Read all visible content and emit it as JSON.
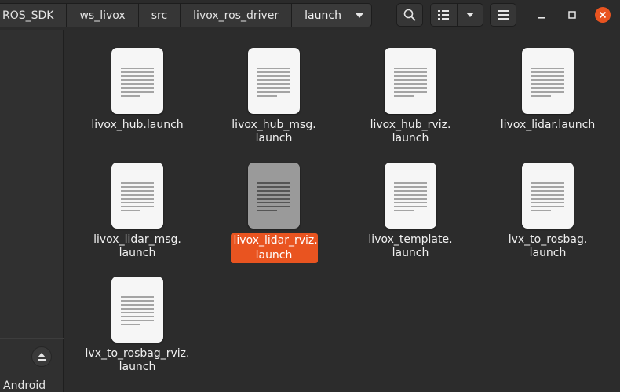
{
  "breadcrumbs": [
    {
      "label": "ROS_SDK"
    },
    {
      "label": "ws_livox"
    },
    {
      "label": "src"
    },
    {
      "label": "livox_ros_driver"
    },
    {
      "label": "launch"
    }
  ],
  "toolbar": {
    "search_icon": "search-icon",
    "view_icon": "list-view-icon",
    "view_options_icon": "chevron-down-icon",
    "menu_icon": "hamburger-menu-icon"
  },
  "sidebar": {
    "device_label": "Android",
    "eject_icon": "eject-icon"
  },
  "files": [
    {
      "line1": "livox_hub.launch",
      "line2": ""
    },
    {
      "line1": "livox_hub_msg.",
      "line2": "launch"
    },
    {
      "line1": "livox_hub_rviz.",
      "line2": "launch"
    },
    {
      "line1": "livox_lidar.launch",
      "line2": ""
    },
    {
      "line1": "livox_lidar_msg.",
      "line2": "launch"
    },
    {
      "line1": "livox_lidar_rviz.",
      "line2": "launch",
      "selected": true
    },
    {
      "line1": "livox_template.",
      "line2": "launch"
    },
    {
      "line1": "lvx_to_rosbag.",
      "line2": "launch"
    },
    {
      "line1": "lvx_to_rosbag_rviz.",
      "line2": "launch"
    }
  ],
  "colors": {
    "accent": "#e95420",
    "background": "#2c2c2c",
    "sidebar": "#303030"
  }
}
